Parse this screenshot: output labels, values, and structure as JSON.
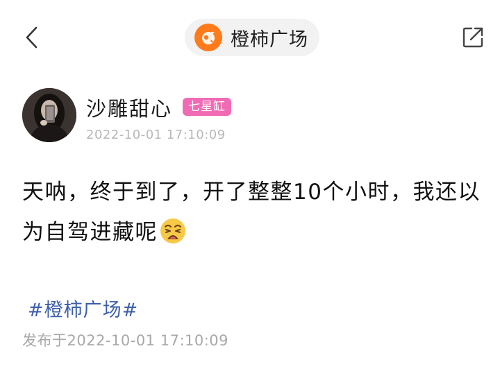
{
  "header": {
    "topic_name": "橙柿广场",
    "back_icon": "chevron-left-icon",
    "share_icon": "share-external-icon",
    "topic_logo_color": "#ff7a1a"
  },
  "author": {
    "name": "沙雕甜心",
    "badge": "七星缸",
    "badge_color": "#f06bb4",
    "time": "2022-10-01 17:10:09"
  },
  "post": {
    "text": "天呐，终于到了，开了整整10个小时，我还以为自驾进藏呢",
    "emoji": "weary-face-emoji",
    "hashtag": "#橙柿广场#",
    "hashtag_color": "#3d5fa8",
    "published": "发布于2022-10-01 17:10:09"
  }
}
